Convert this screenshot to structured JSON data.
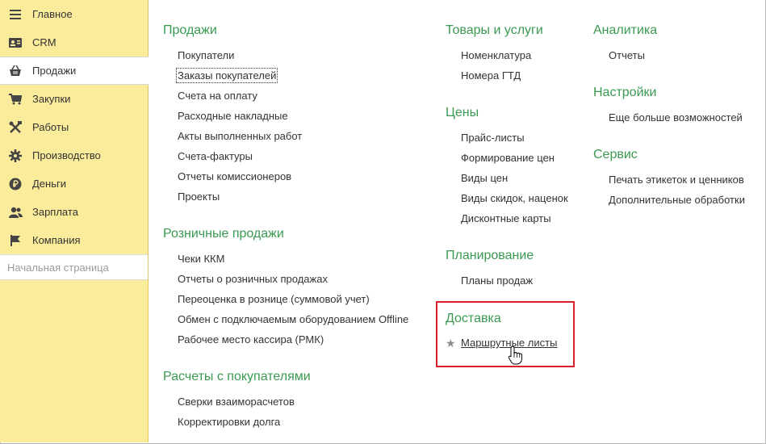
{
  "sidebar": {
    "items": [
      {
        "label": "Главное",
        "icon": "menu-icon"
      },
      {
        "label": "CRM",
        "icon": "crm-card-icon"
      },
      {
        "label": "Продажи",
        "icon": "basket-icon"
      },
      {
        "label": "Закупки",
        "icon": "cart-icon"
      },
      {
        "label": "Работы",
        "icon": "tools-icon"
      },
      {
        "label": "Производство",
        "icon": "gear-icon"
      },
      {
        "label": "Деньги",
        "icon": "ruble-coin-icon"
      },
      {
        "label": "Зарплата",
        "icon": "people-icon"
      },
      {
        "label": "Компания",
        "icon": "flag-icon"
      }
    ],
    "home": "Начальная страница"
  },
  "sections": {
    "sales": {
      "title": "Продажи",
      "links": [
        "Покупатели",
        "Заказы покупателей",
        "Счета на оплату",
        "Расходные накладные",
        "Акты выполненных работ",
        "Счета-фактуры",
        "Отчеты комиссионеров",
        "Проекты"
      ]
    },
    "retail": {
      "title": "Розничные продажи",
      "links": [
        "Чеки ККМ",
        "Отчеты о розничных продажах",
        "Переоценка в рознице (суммовой учет)",
        "Обмен с подключаемым оборудованием Offline",
        "Рабочее место кассира (РМК)"
      ]
    },
    "settlements": {
      "title": "Расчеты с покупателями",
      "links": [
        "Сверки взаиморасчетов",
        "Корректировки долга"
      ]
    },
    "goods": {
      "title": "Товары и услуги",
      "links": [
        "Номенклатура",
        "Номера ГТД"
      ]
    },
    "prices": {
      "title": "Цены",
      "links": [
        "Прайс-листы",
        "Формирование цен",
        "Виды цен",
        "Виды скидок, наценок",
        "Дисконтные карты"
      ]
    },
    "planning": {
      "title": "Планирование",
      "links": [
        "Планы продаж"
      ]
    },
    "delivery": {
      "title": "Доставка",
      "links": [
        "Маршрутные листы"
      ]
    },
    "analytics": {
      "title": "Аналитика",
      "links": [
        "Отчеты"
      ]
    },
    "settings": {
      "title": "Настройки",
      "links": [
        "Еще больше возможностей"
      ]
    },
    "service": {
      "title": "Сервис",
      "links": [
        "Печать этикеток и ценников",
        "Дополнительные обработки"
      ]
    }
  },
  "colors": {
    "sidebar_bg": "#fbec9c",
    "section_title": "#3a9a52",
    "highlight_border": "#d8202a"
  }
}
